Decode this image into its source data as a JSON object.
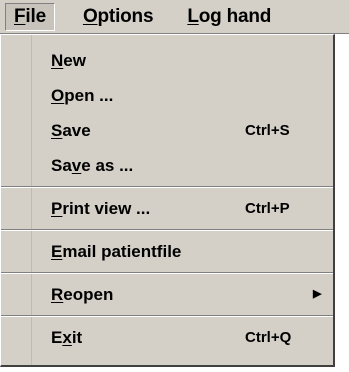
{
  "menubar": {
    "file": {
      "mnemonic": "F",
      "rest": "ile"
    },
    "options": {
      "mnemonic": "O",
      "rest": "ptions"
    },
    "loghand": {
      "mnemonic": "L",
      "rest": "og hand"
    }
  },
  "menu": {
    "new": {
      "mnemonic": "N",
      "rest": "ew"
    },
    "open": {
      "mnemonic": "O",
      "rest": "pen ..."
    },
    "save": {
      "mnemonic": "S",
      "rest": "ave",
      "shortcut": "Ctrl+S"
    },
    "saveas": {
      "pre": "Sa",
      "mnemonic": "v",
      "rest": "e as ..."
    },
    "print": {
      "mnemonic": "P",
      "rest": "rint view ...",
      "shortcut": "Ctrl+P"
    },
    "email": {
      "mnemonic": "E",
      "rest": "mail patientfile"
    },
    "reopen": {
      "mnemonic": "R",
      "rest": "eopen",
      "arrow": "▶"
    },
    "exit": {
      "pre": "E",
      "mnemonic": "x",
      "rest": "it",
      "shortcut": "Ctrl+Q"
    }
  }
}
